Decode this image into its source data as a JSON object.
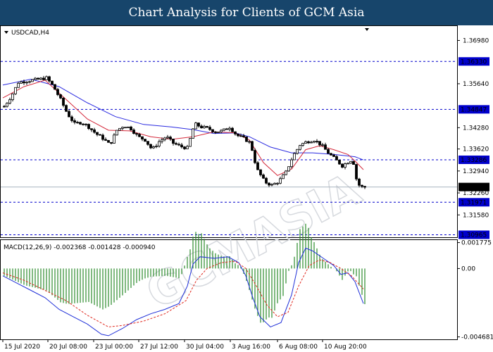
{
  "header": {
    "title": "Chart Analysis for Clients of GCM Asia"
  },
  "watermark": "GCMASIA",
  "chart_data": {
    "type": "candlestick",
    "symbol_label": "USDCAD,H4",
    "price_axis": {
      "ticks": [
        "1.36980",
        "1.35640",
        "1.34280",
        "1.33620",
        "1.32940",
        "1.32260",
        "1.31580"
      ],
      "tick_values": [
        1.3698,
        1.3564,
        1.3428,
        1.3362,
        1.3294,
        1.3226,
        1.3158
      ],
      "ylim": [
        1.3091,
        1.3736
      ]
    },
    "levels": [
      {
        "label": "1.36330",
        "value": 1.3633,
        "style": "dashed",
        "color": "#0000cc"
      },
      {
        "label": "1.34847",
        "value": 1.34847,
        "style": "dashed",
        "color": "#0000cc"
      },
      {
        "label": "1.33286",
        "value": 1.33286,
        "style": "dashed",
        "color": "#0000cc"
      },
      {
        "label": "1.32443",
        "value": 1.32443,
        "style": "solid",
        "color": "#aab4c0"
      },
      {
        "label": "1.31971",
        "value": 1.31971,
        "style": "dashed",
        "color": "#0000cc"
      },
      {
        "label": "1.30965",
        "value": 1.30965,
        "style": "dashed",
        "color": "#0000cc"
      }
    ],
    "current_price_label": "1.32443",
    "x_labels": [
      "15 Jul 2020",
      "20 Jul 08:00",
      "23 Jul 00:00",
      "27 Jul 12:00",
      "30 Jul 04:00",
      "3 Aug 16:00",
      "6 Aug 08:00",
      "10 Aug 20:00"
    ],
    "close_path": [
      [
        0,
        1.3494
      ],
      [
        10,
        1.3525
      ],
      [
        20,
        1.3568
      ],
      [
        30,
        1.3572
      ],
      [
        40,
        1.3575
      ],
      [
        50,
        1.3578
      ],
      [
        60,
        1.3582
      ],
      [
        70,
        1.3555
      ],
      [
        80,
        1.3515
      ],
      [
        90,
        1.347
      ],
      [
        100,
        1.344
      ],
      [
        110,
        1.3445
      ],
      [
        120,
        1.343
      ],
      [
        130,
        1.341
      ],
      [
        140,
        1.3395
      ],
      [
        150,
        1.3375
      ],
      [
        160,
        1.342
      ],
      [
        170,
        1.3435
      ],
      [
        180,
        1.3425
      ],
      [
        190,
        1.34
      ],
      [
        200,
        1.339
      ],
      [
        210,
        1.336
      ],
      [
        220,
        1.3385
      ],
      [
        230,
        1.34
      ],
      [
        240,
        1.338
      ],
      [
        250,
        1.337
      ],
      [
        260,
        1.3365
      ],
      [
        265,
        1.34
      ],
      [
        270,
        1.344
      ],
      [
        280,
        1.343
      ],
      [
        290,
        1.3425
      ],
      [
        300,
        1.3415
      ],
      [
        310,
        1.3418
      ],
      [
        320,
        1.343
      ],
      [
        330,
        1.3405
      ],
      [
        340,
        1.3395
      ],
      [
        350,
        1.338
      ],
      [
        355,
        1.333
      ],
      [
        360,
        1.3295
      ],
      [
        370,
        1.326
      ],
      [
        380,
        1.325
      ],
      [
        390,
        1.3262
      ],
      [
        400,
        1.329
      ],
      [
        410,
        1.334
      ],
      [
        420,
        1.3375
      ],
      [
        430,
        1.3385
      ],
      [
        440,
        1.339
      ],
      [
        450,
        1.3375
      ],
      [
        460,
        1.335
      ],
      [
        470,
        1.333
      ],
      [
        480,
        1.331
      ],
      [
        490,
        1.3325
      ],
      [
        495,
        1.333
      ],
      [
        500,
        1.327
      ],
      [
        505,
        1.3245
      ],
      [
        512,
        1.3244
      ]
    ],
    "ma_slow": [
      [
        0,
        1.356
      ],
      [
        40,
        1.3578
      ],
      [
        80,
        1.3555
      ],
      [
        120,
        1.3505
      ],
      [
        160,
        1.3462
      ],
      [
        200,
        1.3438
      ],
      [
        240,
        1.343
      ],
      [
        270,
        1.3422
      ],
      [
        300,
        1.341
      ],
      [
        330,
        1.3412
      ],
      [
        350,
        1.34
      ],
      [
        380,
        1.3368
      ],
      [
        410,
        1.335
      ],
      [
        440,
        1.335
      ],
      [
        470,
        1.3345
      ],
      [
        500,
        1.3338
      ],
      [
        512,
        1.3328
      ]
    ],
    "ma_fast": [
      [
        0,
        1.352
      ],
      [
        30,
        1.3555
      ],
      [
        60,
        1.3575
      ],
      [
        90,
        1.3515
      ],
      [
        120,
        1.3455
      ],
      [
        150,
        1.342
      ],
      [
        180,
        1.3418
      ],
      [
        210,
        1.34
      ],
      [
        240,
        1.3392
      ],
      [
        270,
        1.34
      ],
      [
        300,
        1.3415
      ],
      [
        330,
        1.3412
      ],
      [
        350,
        1.339
      ],
      [
        370,
        1.332
      ],
      [
        390,
        1.328
      ],
      [
        410,
        1.33
      ],
      [
        430,
        1.336
      ],
      [
        450,
        1.3372
      ],
      [
        470,
        1.336
      ],
      [
        490,
        1.3345
      ],
      [
        500,
        1.3325
      ],
      [
        512,
        1.3298
      ]
    ],
    "macd": {
      "label": "MACD(12,26,9) -0.002368 -0.001428 -0.000940",
      "ticks": [
        "0.001775",
        "0.00",
        "-0.004681"
      ],
      "tick_values": [
        0.001775,
        0.0,
        -0.004681
      ],
      "ylim": [
        -0.0048,
        0.0019
      ],
      "macd_line": [
        [
          0,
          -0.0005
        ],
        [
          20,
          -0.001
        ],
        [
          40,
          -0.0015
        ],
        [
          60,
          -0.002
        ],
        [
          80,
          -0.0028
        ],
        [
          100,
          -0.0033
        ],
        [
          120,
          -0.0038
        ],
        [
          140,
          -0.0045
        ],
        [
          150,
          -0.0046
        ],
        [
          170,
          -0.0041
        ],
        [
          190,
          -0.0035
        ],
        [
          210,
          -0.0031
        ],
        [
          230,
          -0.0028
        ],
        [
          250,
          -0.0024
        ],
        [
          262,
          -0.0012
        ],
        [
          270,
          0.0003
        ],
        [
          280,
          0.0008
        ],
        [
          300,
          0.0007
        ],
        [
          320,
          0.0008
        ],
        [
          335,
          0.0004
        ],
        [
          345,
          -0.0005
        ],
        [
          355,
          -0.002
        ],
        [
          365,
          -0.0033
        ],
        [
          380,
          -0.004
        ],
        [
          395,
          -0.0037
        ],
        [
          410,
          -0.0018
        ],
        [
          420,
          0.0004
        ],
        [
          430,
          0.0014
        ],
        [
          440,
          0.0012
        ],
        [
          455,
          0.0007
        ],
        [
          470,
          0.0002
        ],
        [
          480,
          -0.0004
        ],
        [
          490,
          -0.0003
        ],
        [
          500,
          -0.0009
        ],
        [
          512,
          -0.0024
        ]
      ],
      "signal_line": [
        [
          0,
          -0.0003
        ],
        [
          30,
          -0.0008
        ],
        [
          60,
          -0.0015
        ],
        [
          90,
          -0.0022
        ],
        [
          120,
          -0.0032
        ],
        [
          150,
          -0.004
        ],
        [
          170,
          -0.0039
        ],
        [
          200,
          -0.0036
        ],
        [
          230,
          -0.0031
        ],
        [
          260,
          -0.0022
        ],
        [
          275,
          -0.0008
        ],
        [
          290,
          0.0
        ],
        [
          310,
          0.0004
        ],
        [
          330,
          0.0005
        ],
        [
          345,
          0.0
        ],
        [
          360,
          -0.0012
        ],
        [
          375,
          -0.0025
        ],
        [
          390,
          -0.0033
        ],
        [
          405,
          -0.003
        ],
        [
          420,
          -0.0012
        ],
        [
          435,
          0.0002
        ],
        [
          450,
          0.0006
        ],
        [
          465,
          0.0004
        ],
        [
          480,
          0.0
        ],
        [
          495,
          -0.0005
        ],
        [
          512,
          -0.0014
        ]
      ]
    }
  }
}
